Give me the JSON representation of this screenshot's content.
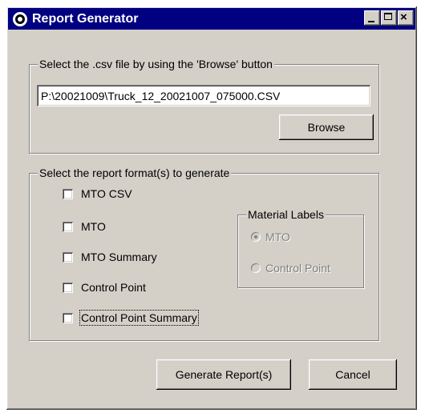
{
  "window": {
    "title": "Report Generator",
    "icon": "app-icon"
  },
  "title_buttons": {
    "minimize": "minimize",
    "maximize": "maximize",
    "close": "×"
  },
  "file_group": {
    "legend": "Select the .csv file by using the 'Browse' button",
    "path_value": "P:\\20021009\\Truck_12_20021007_075000.CSV",
    "browse_label": "Browse"
  },
  "format_group": {
    "legend": "Select the report format(s) to generate",
    "options": [
      {
        "label": "MTO CSV",
        "checked": false
      },
      {
        "label": "MTO",
        "checked": false
      },
      {
        "label": "MTO Summary",
        "checked": false
      },
      {
        "label": "Control Point",
        "checked": false
      },
      {
        "label": "Control Point Summary",
        "checked": false,
        "focused": true
      }
    ]
  },
  "material_labels": {
    "legend": "Material Labels",
    "enabled": false,
    "options": [
      {
        "label": "MTO",
        "selected": true
      },
      {
        "label": "Control Point",
        "selected": false
      }
    ]
  },
  "actions": {
    "generate_label": "Generate Report(s)",
    "cancel_label": "Cancel"
  },
  "colors": {
    "titlebar": "#000080",
    "face": "#d4d0c8",
    "shadow": "#808080",
    "highlight": "#ffffff"
  }
}
